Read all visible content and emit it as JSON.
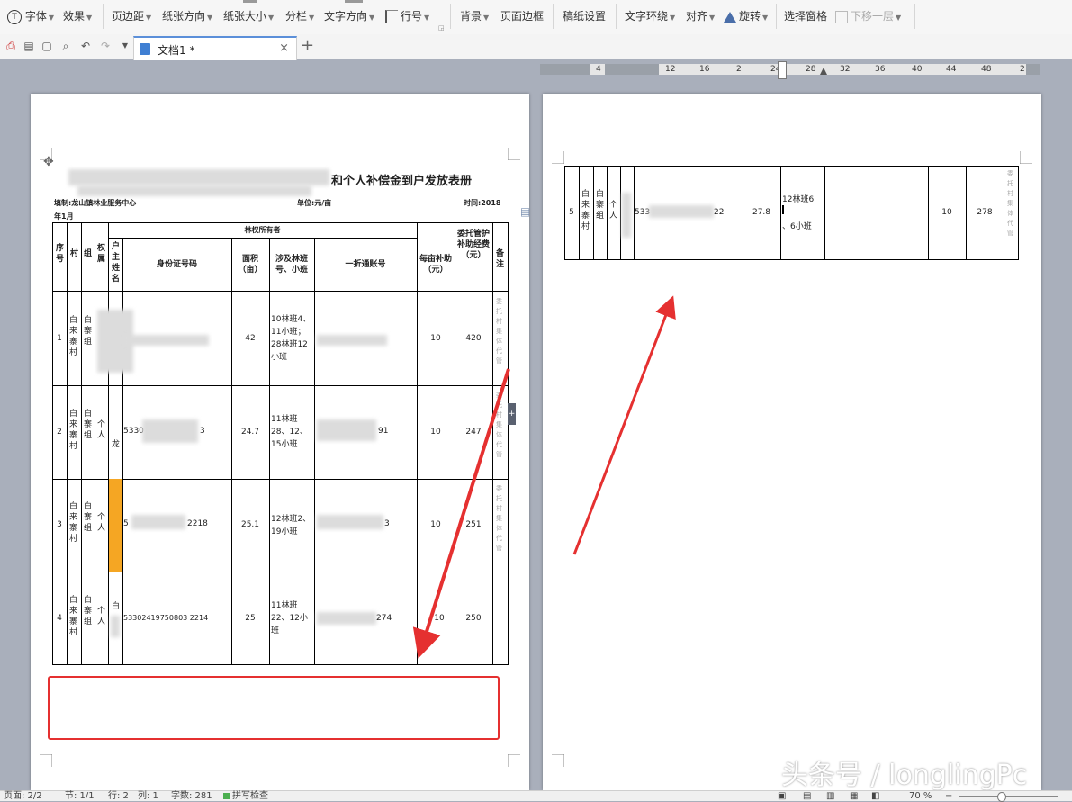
{
  "toolbar": {
    "font": "字体",
    "effect": "效果",
    "margins": "页边距",
    "orientation": "纸张方向",
    "size": "纸张大小",
    "columns": "分栏",
    "text_direction": "文字方向",
    "line_numbers": "行号",
    "background": "背景",
    "page_border": "页面边框",
    "grid_paper": "稿纸设置",
    "wrap_text": "文字环绕",
    "align": "对齐",
    "rotate": "旋转",
    "selection_pane": "选择窗格",
    "send_backward": "下移一层"
  },
  "tab": {
    "title": "文档1 *",
    "close": "×",
    "new": "+"
  },
  "ruler": {
    "ticks": [
      "4",
      "12",
      "16",
      "2",
      "24",
      "28",
      "32",
      "36",
      "40",
      "44",
      "48",
      "2"
    ]
  },
  "page1": {
    "title": "和个人补偿金到户发放表册",
    "header_left": "填制:龙山镇林业服务中心",
    "header_mid": "单位:元/亩",
    "header_right": "时间:2018",
    "header_year": "年1月",
    "group_header": "林权所有者",
    "columns": [
      "序号",
      "村",
      "组",
      "权属",
      "户主姓名",
      "身份证号码",
      "面积（亩）",
      "涉及林班号、小班",
      "一折通账号",
      "每亩补助（元）",
      "委托管护补助经费（元）",
      "备注"
    ],
    "rows": [
      {
        "no": "1",
        "village": "白来寨村",
        "group": "白寨组",
        "type": "",
        "name": "",
        "id": "",
        "area": "42",
        "plots": "10林班4、11小班；28林班12小班",
        "account": "",
        "rate": "10",
        "amount": "420",
        "note": "委托村集体代管"
      },
      {
        "no": "2",
        "village": "白来寨村",
        "group": "白寨组",
        "type": "个人",
        "name": "龙",
        "id_start": "5330",
        "id_end": "3",
        "area": "24.7",
        "plots": "11林班28、12、15小班",
        "account_end": "91",
        "rate": "10",
        "amount": "247",
        "note": "委托村集体代管"
      },
      {
        "no": "3",
        "village": "白来寨村",
        "group": "白寨组",
        "type": "个人",
        "name": "",
        "id_start": "5",
        "id_end": "2218",
        "area": "25.1",
        "plots": "12林班2、19小班",
        "account_end": "3",
        "rate": "10",
        "amount": "251",
        "note": "委托村集体代管"
      },
      {
        "no": "4",
        "village": "白来寨村",
        "group": "白寨组",
        "type": "个人",
        "name": "白",
        "id": "53302419750803 2214",
        "area": "25",
        "plots": "11林班22、12小班",
        "account_end": "274",
        "rate": "10",
        "amount": "250",
        "note": ""
      }
    ]
  },
  "page2": {
    "row": {
      "no": "5",
      "village": "白来寨村",
      "group": "白寨组",
      "type": "个人",
      "id_start": "533",
      "id_end": "22",
      "area": "27.8",
      "plots_1": "12林班6",
      "plots_2": "、6小班",
      "rate": "10",
      "amount": "278",
      "note": "委托村集体代管"
    }
  },
  "status": {
    "page": "页面: 2/2",
    "section": "节: 1/1",
    "line": "行: 2",
    "col": "列: 1",
    "words": "字数: 281",
    "spell": "拼写检查",
    "zoom": "70 %"
  },
  "watermark": "头条号 / longlingPc",
  "colors": {
    "annotation_red": "#e53030",
    "highlight_orange": "#f5a623",
    "accent_blue": "#5b8fd9"
  }
}
